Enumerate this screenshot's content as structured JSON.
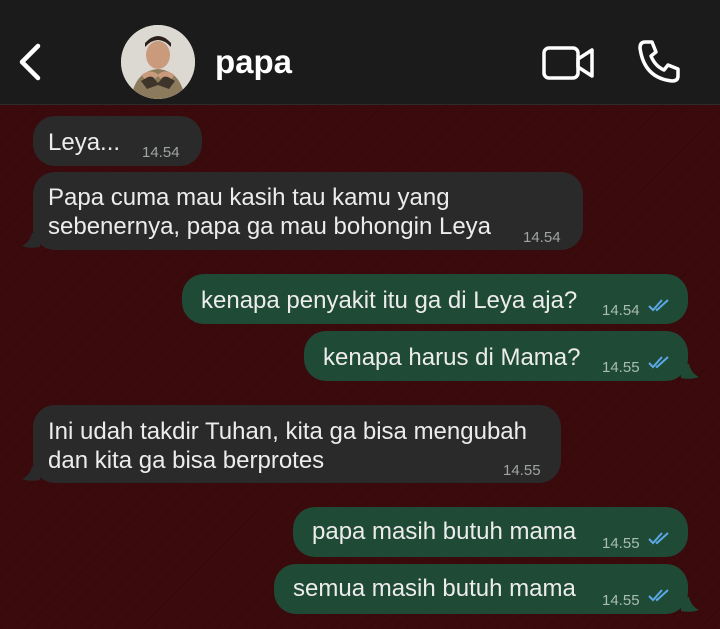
{
  "header": {
    "contact_name": "papa",
    "back_icon": "chevron-left-icon",
    "video_icon": "video-camera-icon",
    "call_icon": "phone-icon"
  },
  "colors": {
    "header_bg": "#1b1b1b",
    "chat_bg": "#3b0a0c",
    "incoming_bubble": "#2a2a2a",
    "outgoing_bubble": "#1f4a35",
    "read_ticks": "#5aa8e6"
  },
  "messages": [
    {
      "direction": "in",
      "lines": [
        "Leya..."
      ],
      "time": "14.54"
    },
    {
      "direction": "in",
      "lines": [
        "Papa cuma mau kasih tau kamu yang",
        "sebenernya, papa ga mau bohongin Leya"
      ],
      "time": "14.54"
    },
    {
      "direction": "out",
      "lines": [
        "kenapa penyakit itu ga di Leya aja?"
      ],
      "time": "14.54",
      "status": "read"
    },
    {
      "direction": "out",
      "lines": [
        "kenapa harus di Mama?"
      ],
      "time": "14.55",
      "status": "read"
    },
    {
      "direction": "in",
      "lines": [
        "Ini udah takdir Tuhan, kita ga bisa mengubah",
        "dan kita ga bisa berprotes"
      ],
      "time": "14.55"
    },
    {
      "direction": "out",
      "lines": [
        "papa masih butuh mama"
      ],
      "time": "14.55",
      "status": "read"
    },
    {
      "direction": "out",
      "lines": [
        "semua masih butuh mama"
      ],
      "time": "14.55",
      "status": "read"
    }
  ]
}
